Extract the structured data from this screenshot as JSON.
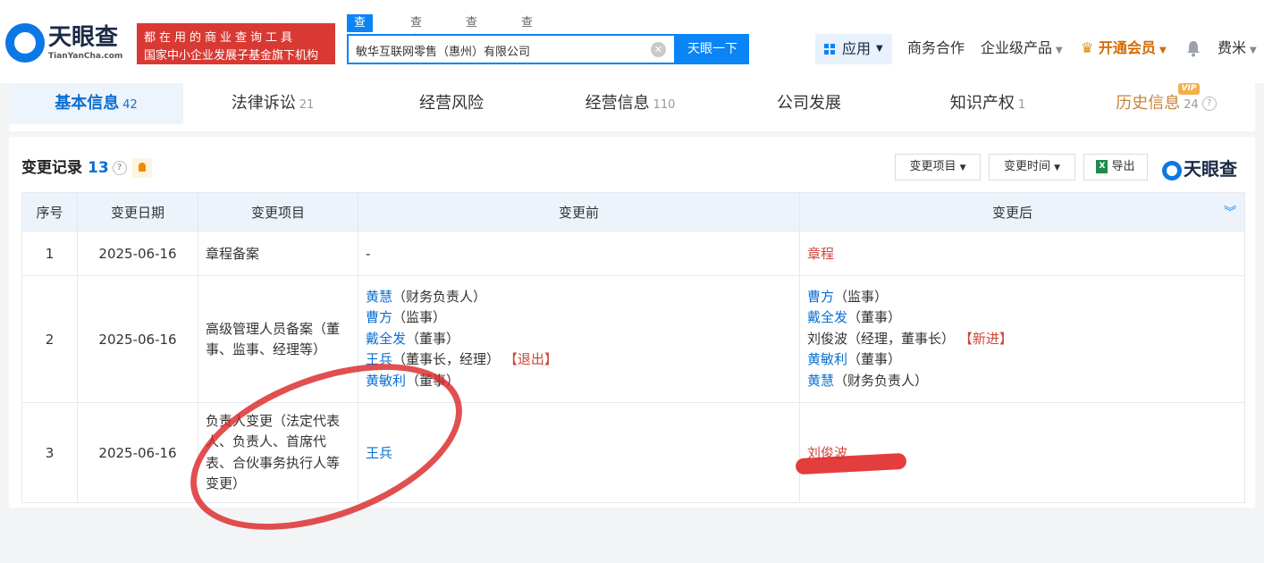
{
  "brand": {
    "name": "天眼查",
    "domain": "TianYanCha.com"
  },
  "slogan": {
    "line1": "都在用的商业查询工具",
    "line2": "国家中小企业发展子基金旗下机构"
  },
  "search": {
    "tabs": [
      "查公司",
      "查老板",
      "查关系",
      "查风险"
    ],
    "active_tab": 0,
    "query": "敏华互联网零售（惠州）有限公司",
    "button": "天眼一下"
  },
  "nav": {
    "apps": "应用",
    "business": "商务合作",
    "enterprise": "企业级产品",
    "vip": "开通会员",
    "user": "费米"
  },
  "tabs": [
    {
      "label": "基本信息",
      "count": "42"
    },
    {
      "label": "法律诉讼",
      "count": "21"
    },
    {
      "label": "经营风险",
      "count": ""
    },
    {
      "label": "经营信息",
      "count": "110"
    },
    {
      "label": "公司发展",
      "count": ""
    },
    {
      "label": "知识产权",
      "count": "1"
    },
    {
      "label": "历史信息",
      "count": "24",
      "badge": "VIP"
    }
  ],
  "section": {
    "title": "变更记录",
    "count": "13",
    "filter_item": "变更项目",
    "filter_time": "变更时间",
    "export": "导出",
    "brand": "天眼查"
  },
  "table": {
    "headers": [
      "序号",
      "变更日期",
      "变更项目",
      "变更前",
      "变更后"
    ],
    "rows": [
      {
        "no": "1",
        "date": "2025-06-16",
        "item": "章程备案",
        "before": [
          {
            "text": "-"
          }
        ],
        "after": [
          {
            "name": "章程",
            "style": "red"
          }
        ]
      },
      {
        "no": "2",
        "date": "2025-06-16",
        "item": "高级管理人员备案（董事、监事、经理等）",
        "before": [
          {
            "name": "黄慧",
            "role": "（财务负责人）"
          },
          {
            "name": "曹方",
            "role": "（监事）"
          },
          {
            "name": "戴全发",
            "role": "（董事）"
          },
          {
            "name": "王兵",
            "role": "（董事长，经理）",
            "tag": "【退出】"
          },
          {
            "name": "黄敏利",
            "role": "（董事）"
          }
        ],
        "after": [
          {
            "name": "曹方",
            "role": "（监事）"
          },
          {
            "name": "戴全发",
            "role": "（董事）"
          },
          {
            "name": "刘俊波",
            "role": "（经理，董事长）",
            "tag": "【新进】",
            "plain": true
          },
          {
            "name": "黄敏利",
            "role": "（董事）"
          },
          {
            "name": "黄慧",
            "role": "（财务负责人）"
          }
        ]
      },
      {
        "no": "3",
        "date": "2025-06-16",
        "item": "负责人变更（法定代表人、负责人、首席代表、合伙事务执行人等变更）",
        "before": [
          {
            "name": "王兵"
          }
        ],
        "after": [
          {
            "name": "刘俊波",
            "style": "red"
          }
        ]
      }
    ]
  },
  "colors": {
    "accent": "#0b84f5",
    "link": "#0b6fd1",
    "alert": "#d0453a",
    "brand_red": "#d83a33"
  }
}
